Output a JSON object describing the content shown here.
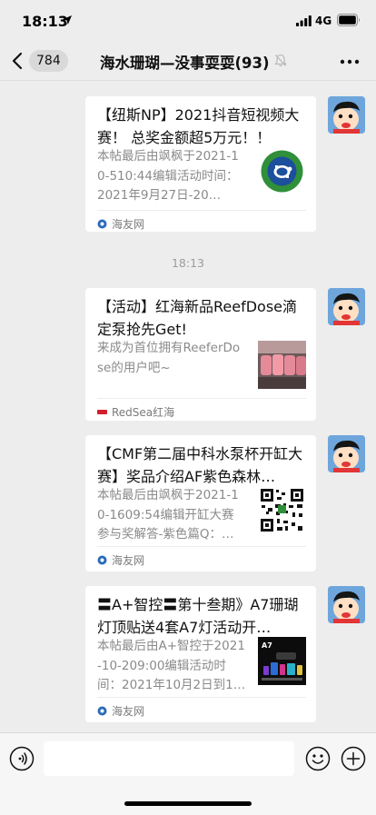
{
  "status_bar": {
    "time": "18:13",
    "network": "4G"
  },
  "nav": {
    "unread_count": "784",
    "title": "海水珊瑚—没事耍耍(93)"
  },
  "messages": [
    {
      "title": "【纽斯NP】2021抖音短视频大赛！ 总奖金额超5万元！！",
      "desc": "本帖最后由飒枫于2021-10-510:44编辑活动时间：2021年9月27日-20…",
      "source": "海友网",
      "thumb_icon": "turtle-logo-icon"
    },
    {
      "title": "【活动】红海新品ReefDose滴定泵抢先Get!",
      "desc": "来成为首位拥有ReeferDose的用户吧~",
      "source": "RedSea红海",
      "thumb_icon": "product-photo-icon"
    },
    {
      "title": "【CMF第二届中科水泵杯开缸大赛】奖品介绍AF紫色森林…",
      "desc": "本帖最后由飒枫于2021-10-1609:54编辑开缸大赛参与奖解答-紫色篇Q：…",
      "source": "海友网",
      "thumb_icon": "qr-code-icon"
    },
    {
      "title": "〓A+智控〓第十叁期》A7珊瑚灯顶贴送4套A7灯活动开…",
      "desc": "本帖最后由A+智控于2021-10-209:00编辑活动时间：2021年10月2日到1…",
      "source": "海友网",
      "thumb_icon": "light-product-icon",
      "thumb_label": "A7"
    }
  ],
  "time_divider": "18:13",
  "input_bar": {
    "placeholder": ""
  },
  "colors": {
    "background": "#ededed",
    "card": "#ffffff",
    "muted_text": "#8a8a8a"
  }
}
